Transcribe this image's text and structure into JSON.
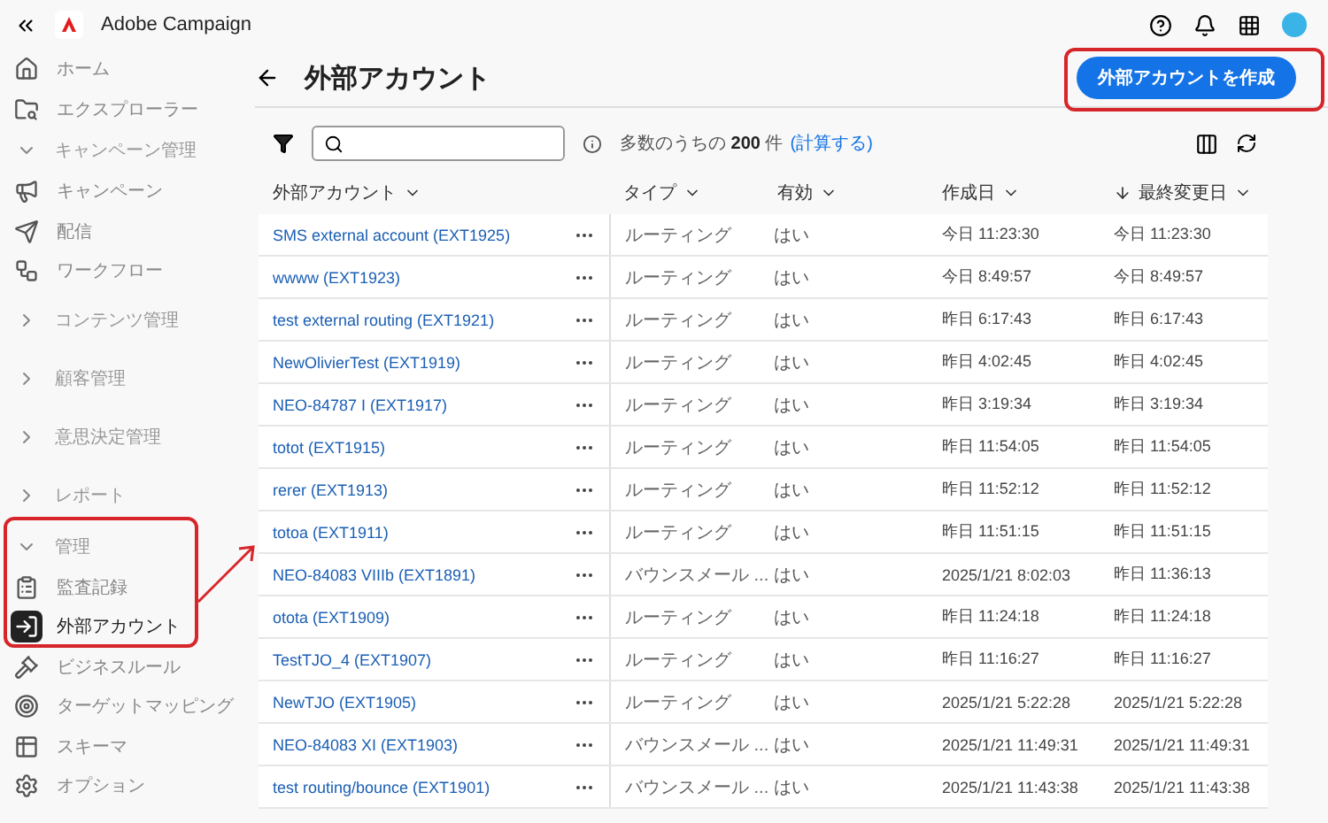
{
  "app": {
    "name": "Adobe Campaign"
  },
  "sidebar": {
    "items": [
      {
        "kind": "link",
        "label": "ホーム",
        "selected": false
      },
      {
        "kind": "link",
        "label": "エクスプローラー",
        "selected": false
      },
      {
        "kind": "section",
        "label": "キャンペーン管理",
        "expanded": true,
        "children": [
          {
            "kind": "link",
            "label": "キャンペーン",
            "selected": false
          },
          {
            "kind": "link",
            "label": "配信",
            "selected": false
          },
          {
            "kind": "link",
            "label": "ワークフロー",
            "selected": false
          }
        ]
      },
      {
        "kind": "section",
        "label": "コンテンツ管理",
        "expanded": false
      },
      {
        "kind": "section",
        "label": "顧客管理",
        "expanded": false
      },
      {
        "kind": "section",
        "label": "意思決定管理",
        "expanded": false
      },
      {
        "kind": "section",
        "label": "レポート",
        "expanded": false
      },
      {
        "kind": "section",
        "label": "管理",
        "expanded": true,
        "children": [
          {
            "kind": "link",
            "label": "監査記録",
            "selected": false
          },
          {
            "kind": "link",
            "label": "外部アカウント",
            "selected": true
          },
          {
            "kind": "link",
            "label": "ビジネスルール",
            "selected": false
          },
          {
            "kind": "link",
            "label": "ターゲットマッピング",
            "selected": false
          },
          {
            "kind": "link",
            "label": "スキーマ",
            "selected": false
          },
          {
            "kind": "link",
            "label": "オプション",
            "selected": false
          }
        ]
      }
    ]
  },
  "page": {
    "title": "外部アカウント",
    "create_button": "外部アカウントを作成"
  },
  "toolbar": {
    "count_text": "多数のうちの **200** 件",
    "compute_link": "(計算する)"
  },
  "table": {
    "columns": [
      {
        "label": "外部アカウント",
        "sorted": false
      },
      {
        "label": "タイプ",
        "sorted": false
      },
      {
        "label": "有効",
        "sorted": false
      },
      {
        "label": "作成日",
        "sorted": false
      },
      {
        "label": "最終変更日",
        "sorted": true
      }
    ],
    "rows": [
      [
        "SMS external account (EXT1925)",
        "ルーティング",
        "はい",
        "今日 11:23:30",
        "今日 11:23:30"
      ],
      [
        "wwww (EXT1923)",
        "ルーティング",
        "はい",
        "今日 8:49:57",
        "今日 8:49:57"
      ],
      [
        "test external routing (EXT1921)",
        "ルーティング",
        "はい",
        "昨日 6:17:43",
        "昨日 6:17:43"
      ],
      [
        "NewOlivierTest (EXT1919)",
        "ルーティング",
        "はい",
        "昨日 4:02:45",
        "昨日 4:02:45"
      ],
      [
        "NEO-84787 I (EXT1917)",
        "ルーティング",
        "はい",
        "昨日 3:19:34",
        "昨日 3:19:34"
      ],
      [
        "totot (EXT1915)",
        "ルーティング",
        "はい",
        "昨日 11:54:05",
        "昨日 11:54:05"
      ],
      [
        "rerer (EXT1913)",
        "ルーティング",
        "はい",
        "昨日 11:52:12",
        "昨日 11:52:12"
      ],
      [
        "totoa (EXT1911)",
        "ルーティング",
        "はい",
        "昨日 11:51:15",
        "昨日 11:51:15"
      ],
      [
        "NEO-84083 VIIIb (EXT1891)",
        "バウンスメール ...",
        "はい",
        "2025/1/21 8:02:03",
        "昨日 11:36:13"
      ],
      [
        "otota (EXT1909)",
        "ルーティング",
        "はい",
        "昨日 11:24:18",
        "昨日 11:24:18"
      ],
      [
        "TestTJO_4 (EXT1907)",
        "ルーティング",
        "はい",
        "昨日 11:16:27",
        "昨日 11:16:27"
      ],
      [
        "NewTJO (EXT1905)",
        "ルーティング",
        "はい",
        "2025/1/21 5:22:28",
        "2025/1/21 5:22:28"
      ],
      [
        "NEO-84083 XI (EXT1903)",
        "バウンスメール ...",
        "はい",
        "2025/1/21 11:49:31",
        "2025/1/21 11:49:31"
      ],
      [
        "test routing/bounce (EXT1901)",
        "バウンスメール ...",
        "はい",
        "2025/1/21 11:43:38",
        "2025/1/21 11:43:38"
      ]
    ]
  }
}
